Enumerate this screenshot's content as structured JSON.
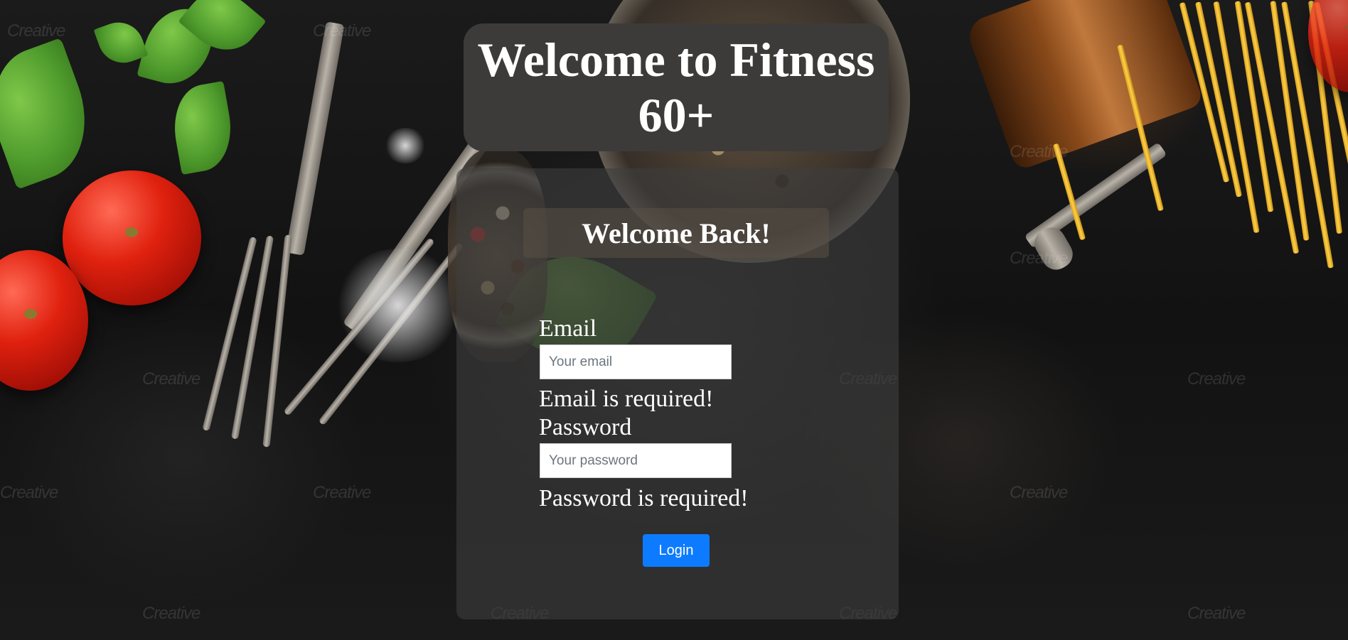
{
  "header": {
    "title": "Welcome to Fitness 60+"
  },
  "login": {
    "heading": "Welcome Back!",
    "email": {
      "label": "Email",
      "placeholder": "Your email",
      "value": "",
      "error": "Email is required!"
    },
    "password": {
      "label": "Password",
      "placeholder": "Your password",
      "value": "",
      "error": "Password is required!"
    },
    "submit_label": "Login"
  },
  "background": {
    "watermark_text": "Creative"
  },
  "colors": {
    "title_box": "#3d3b3a",
    "login_button": "#0d7bff",
    "text": "#ffffff"
  }
}
